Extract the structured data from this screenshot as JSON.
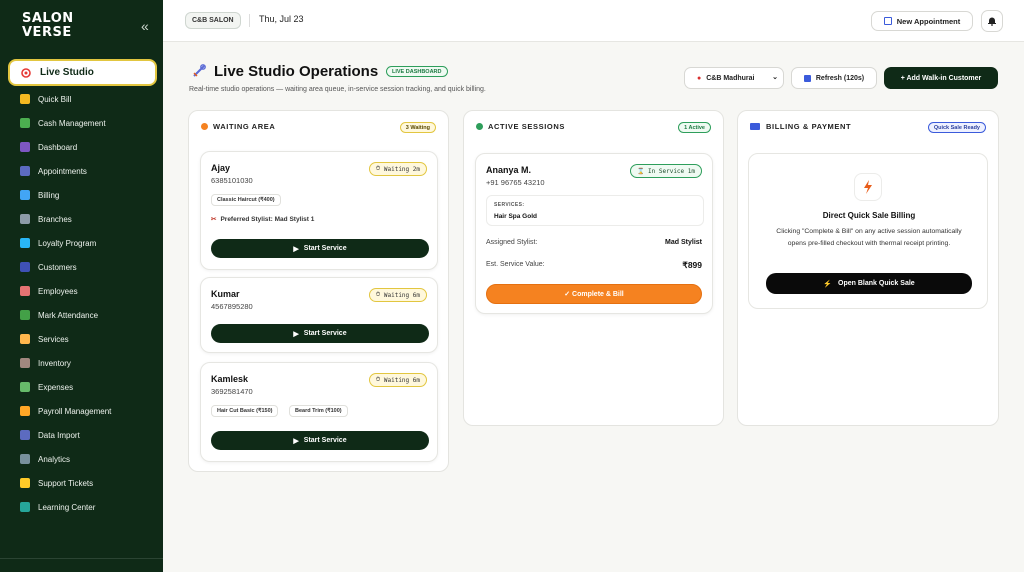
{
  "brand": {
    "line1": "SALON",
    "line2": "VERSE"
  },
  "sidebar": {
    "collapse_icon": "«",
    "active": "Live Studio",
    "items": [
      {
        "label": "Quick Bill",
        "color": "#f5b921"
      },
      {
        "label": "Cash Management",
        "color": "#4caf50"
      },
      {
        "label": "Dashboard",
        "color": "#7e57c2"
      },
      {
        "label": "Appointments",
        "color": "#5c6bc0"
      },
      {
        "label": "Billing",
        "color": "#42a5f5"
      },
      {
        "label": "Branches",
        "color": "#8d9ba8"
      },
      {
        "label": "Loyalty Program",
        "color": "#29b6f6"
      },
      {
        "label": "Customers",
        "color": "#3f51b5"
      },
      {
        "label": "Employees",
        "color": "#e57373"
      },
      {
        "label": "Mark Attendance",
        "color": "#43a047"
      },
      {
        "label": "Services",
        "color": "#ffb74d"
      },
      {
        "label": "Inventory",
        "color": "#a1887f"
      },
      {
        "label": "Expenses",
        "color": "#66bb6a"
      },
      {
        "label": "Payroll Management",
        "color": "#ffa726"
      },
      {
        "label": "Data Import",
        "color": "#5c6bc0"
      },
      {
        "label": "Analytics",
        "color": "#78909c"
      },
      {
        "label": "Support Tickets",
        "color": "#ffca28"
      },
      {
        "label": "Learning Center",
        "color": "#26a69a"
      }
    ]
  },
  "topbar": {
    "branch": "C&B SALON",
    "date": "Thu, Jul 23",
    "new_appointment": "New Appointment"
  },
  "page": {
    "title": "Live Studio Operations",
    "badge": "LIVE DASHBOARD",
    "subtitle": "Real-time studio operations — waiting area queue, in-service session tracking, and quick billing.",
    "branch_select": "C&B Madhurai",
    "refresh": "Refresh (120s)",
    "add_walkin": "+ Add Walk-in Customer"
  },
  "waiting": {
    "title": "WAITING AREA",
    "badge": "3 Waiting",
    "dot_color": "#f58220",
    "cards": [
      {
        "name": "Ajay",
        "phone": "6385101030",
        "status": "Waiting 2m",
        "services": [
          "Classic Haircut (₹400)"
        ],
        "pref_label": "Preferred Stylist: Mad Stylist 1",
        "button": "Start Service"
      },
      {
        "name": "Kumar",
        "phone": "4567895280",
        "status": "Waiting 6m",
        "services": [],
        "pref_label": "",
        "button": "Start Service"
      },
      {
        "name": "Kamlesk",
        "phone": "3692581470",
        "status": "Waiting 6m",
        "services": [
          "Hair Cut Basic (₹150)",
          "Beard Trim (₹100)"
        ],
        "pref_label": "",
        "button": "Start Service"
      }
    ]
  },
  "active": {
    "title": "ACTIVE SESSIONS",
    "badge": "1 Active",
    "dot_color": "#2e9e5b",
    "session": {
      "name": "Ananya M.",
      "phone": "+91 96765 43210",
      "status": "In Service 1m",
      "services_label": "SERVICES:",
      "services_value": "Hair Spa Gold",
      "stylist_label": "Assigned Stylist:",
      "stylist_value": "Mad Stylist",
      "value_label": "Est. Service Value:",
      "value_value": "₹899",
      "button": "✓ Complete & Bill"
    }
  },
  "billing": {
    "title": "BILLING & PAYMENT",
    "badge": "Quick Sale Ready",
    "card_title": "Direct Quick Sale Billing",
    "card_desc": "Clicking \"Complete & Bill\" on any active session automatically opens pre-filled checkout with thermal receipt printing.",
    "button": "Open Blank Quick Sale"
  }
}
